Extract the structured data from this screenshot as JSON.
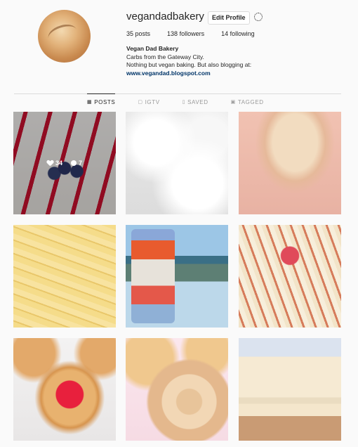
{
  "profile": {
    "username": "vegandadbakery",
    "edit_label": "Edit Profile",
    "posts": "35",
    "posts_label": "posts",
    "followers": "138",
    "followers_label": "followers",
    "following": "14",
    "following_label": "following",
    "bio_name": "Vegan Dad Bakery",
    "bio_line1": "Carbs from the Gateway City.",
    "bio_line2": "Nothing but vegan baking. But also blogging at:",
    "bio_link": "www.vegandad.blogspot.com"
  },
  "tabs": [
    {
      "label": "POSTS",
      "icon": "grid-icon"
    },
    {
      "label": "IGTV",
      "icon": "igtv-icon"
    },
    {
      "label": "SAVED",
      "icon": "bookmark-icon"
    },
    {
      "label": "TAGGED",
      "icon": "tag-icon"
    }
  ],
  "hover": {
    "likes": "34",
    "comments": "7"
  },
  "posts": [
    {
      "subject": "cake with strawberry drizzle and blueberries"
    },
    {
      "subject": "whipped meringue"
    },
    {
      "subject": "bread loaf"
    },
    {
      "subject": "fresh pasta ribbons"
    },
    {
      "subject": "golden lager can by lake"
    },
    {
      "subject": "glazed danish"
    },
    {
      "subject": "jam danish"
    },
    {
      "subject": "spiral pastry dough"
    },
    {
      "subject": "layered dough"
    }
  ],
  "colors": {
    "link": "#003569",
    "accent": "#262626"
  }
}
